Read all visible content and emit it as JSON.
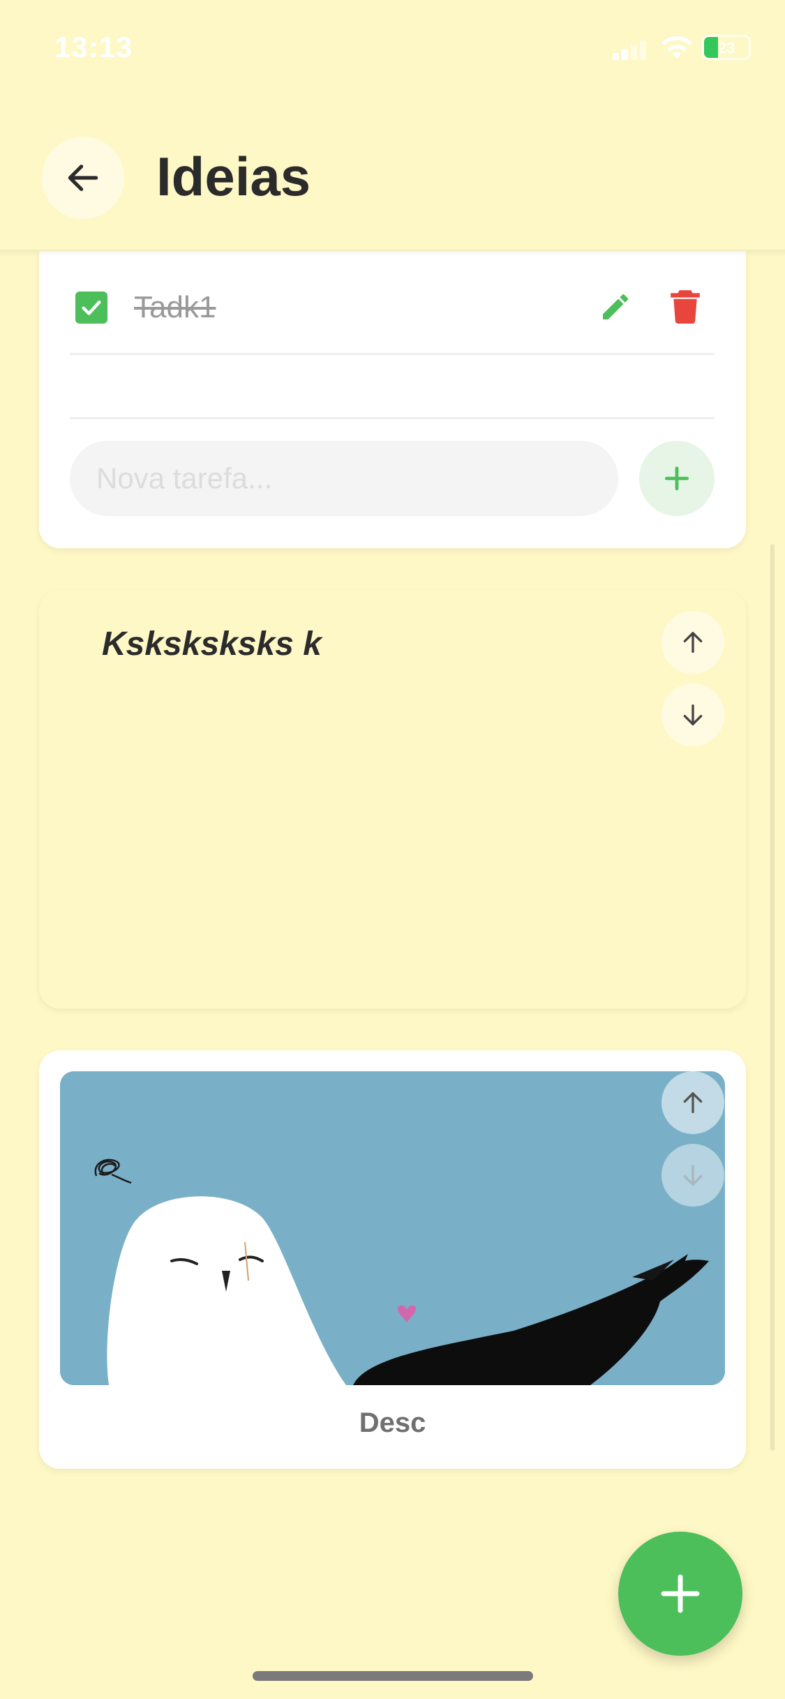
{
  "status_bar": {
    "time": "13:13",
    "battery": "23"
  },
  "header": {
    "title": "Ideias",
    "back_icon": "arrow-left-icon"
  },
  "checklist_card": {
    "tasks": [
      {
        "label": "Tadk1",
        "completed": true
      }
    ],
    "new_task_placeholder": "Nova tarefa...",
    "icons": {
      "edit": "pencil-icon",
      "delete": "trash-icon",
      "add": "plus-icon"
    }
  },
  "note_card": {
    "title": "Ksksksksks k"
  },
  "image_card": {
    "caption": "Desc"
  },
  "colors": {
    "background": "#fef8c6",
    "accent_green": "#4cbe5a",
    "delete_red": "#e8453c",
    "image_bg": "#79b0c7"
  }
}
